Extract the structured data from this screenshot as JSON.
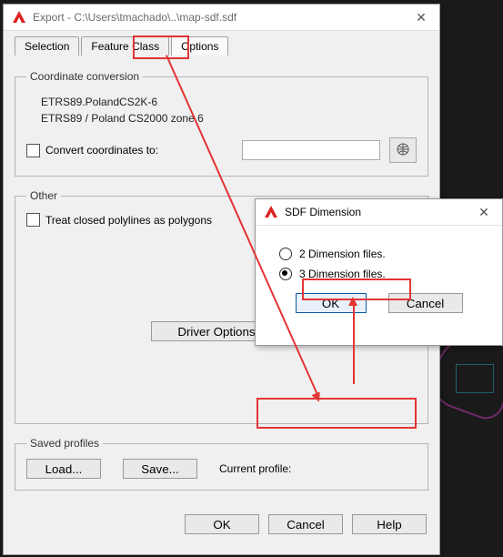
{
  "main_window": {
    "title": "Export - C:\\Users\\tmachado\\..\\map-sdf.sdf",
    "tabs": {
      "selection": "Selection",
      "feature_class": "Feature Class",
      "options": "Options"
    },
    "coord": {
      "legend": "Coordinate conversion",
      "line1": "ETRS89.PolandCS2K-6",
      "line2": "ETRS89 / Poland CS2000 zone 6",
      "convert_label": "Convert coordinates to:"
    },
    "other": {
      "legend": "Other",
      "treat_label": "Treat closed polylines as polygons",
      "driver_btn": "Driver Options..."
    },
    "profiles": {
      "legend": "Saved profiles",
      "load": "Load...",
      "save": "Save...",
      "current_label": "Current profile:"
    },
    "footer": {
      "ok": "OK",
      "cancel": "Cancel",
      "help": "Help"
    }
  },
  "dialog": {
    "title": "SDF Dimension",
    "opt2d": "2 Dimension files.",
    "opt3d": "3 Dimension files.",
    "ok": "OK",
    "cancel": "Cancel"
  }
}
